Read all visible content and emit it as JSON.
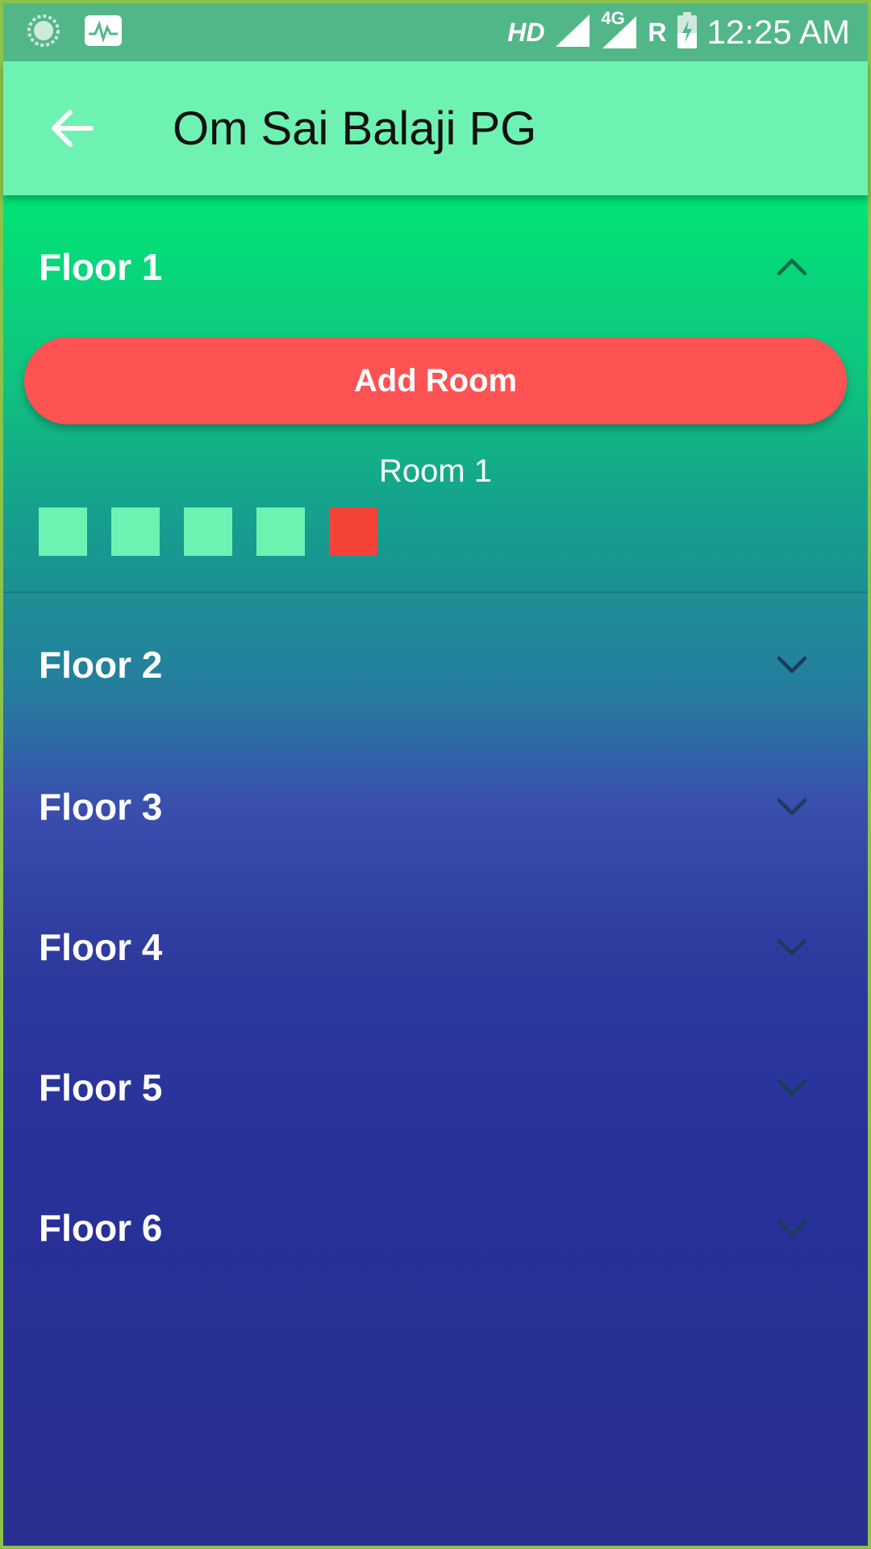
{
  "status_bar": {
    "network_type": "HD",
    "network_label": "4G",
    "roaming": "R",
    "time": "12:25 AM"
  },
  "app_bar": {
    "title": "Om Sai Balaji PG"
  },
  "floor_1": {
    "title": "Floor 1",
    "add_button_label": "Add Room",
    "room_label": "Room 1",
    "beds": [
      "vacant",
      "vacant",
      "vacant",
      "vacant",
      "occupied"
    ],
    "colors": {
      "vacant": "#6ef2b2",
      "occupied": "#f44336"
    }
  },
  "floors": [
    {
      "title": "Floor 2"
    },
    {
      "title": "Floor 3"
    },
    {
      "title": "Floor 4"
    },
    {
      "title": "Floor 5"
    },
    {
      "title": "Floor 6"
    }
  ]
}
